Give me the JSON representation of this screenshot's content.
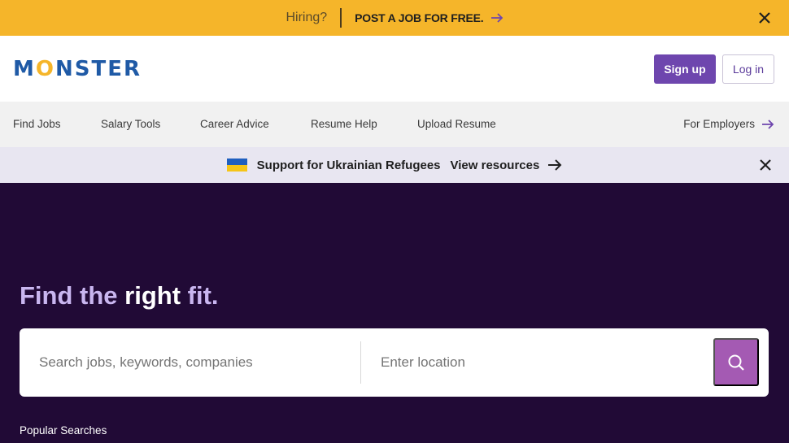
{
  "top_banner": {
    "hiring": "Hiring?",
    "cta": "POST A JOB FOR FREE.",
    "close_icon": "close-icon"
  },
  "header": {
    "logo_text_m": "M",
    "logo_text_o": "O",
    "logo_text_rest": "NSTER",
    "signup": "Sign up",
    "login": "Log in"
  },
  "nav": {
    "items": [
      "Find Jobs",
      "Salary Tools",
      "Career Advice",
      "Resume Help",
      "Upload Resume"
    ],
    "employers": "For Employers"
  },
  "ukraine": {
    "text": "Support for Ukrainian Refugees",
    "link": "View resources"
  },
  "hero": {
    "title_part1": "Find the ",
    "title_em": "right",
    "title_part2": " fit."
  },
  "search": {
    "keywords_placeholder": "Search jobs, keywords, companies",
    "location_placeholder": "Enter location"
  },
  "popular": "Popular Searches",
  "colors": {
    "banner": "#f5b52a",
    "primary": "#6e46ae",
    "hero_bg": "#210a36",
    "search_button": "#a45ab3"
  }
}
